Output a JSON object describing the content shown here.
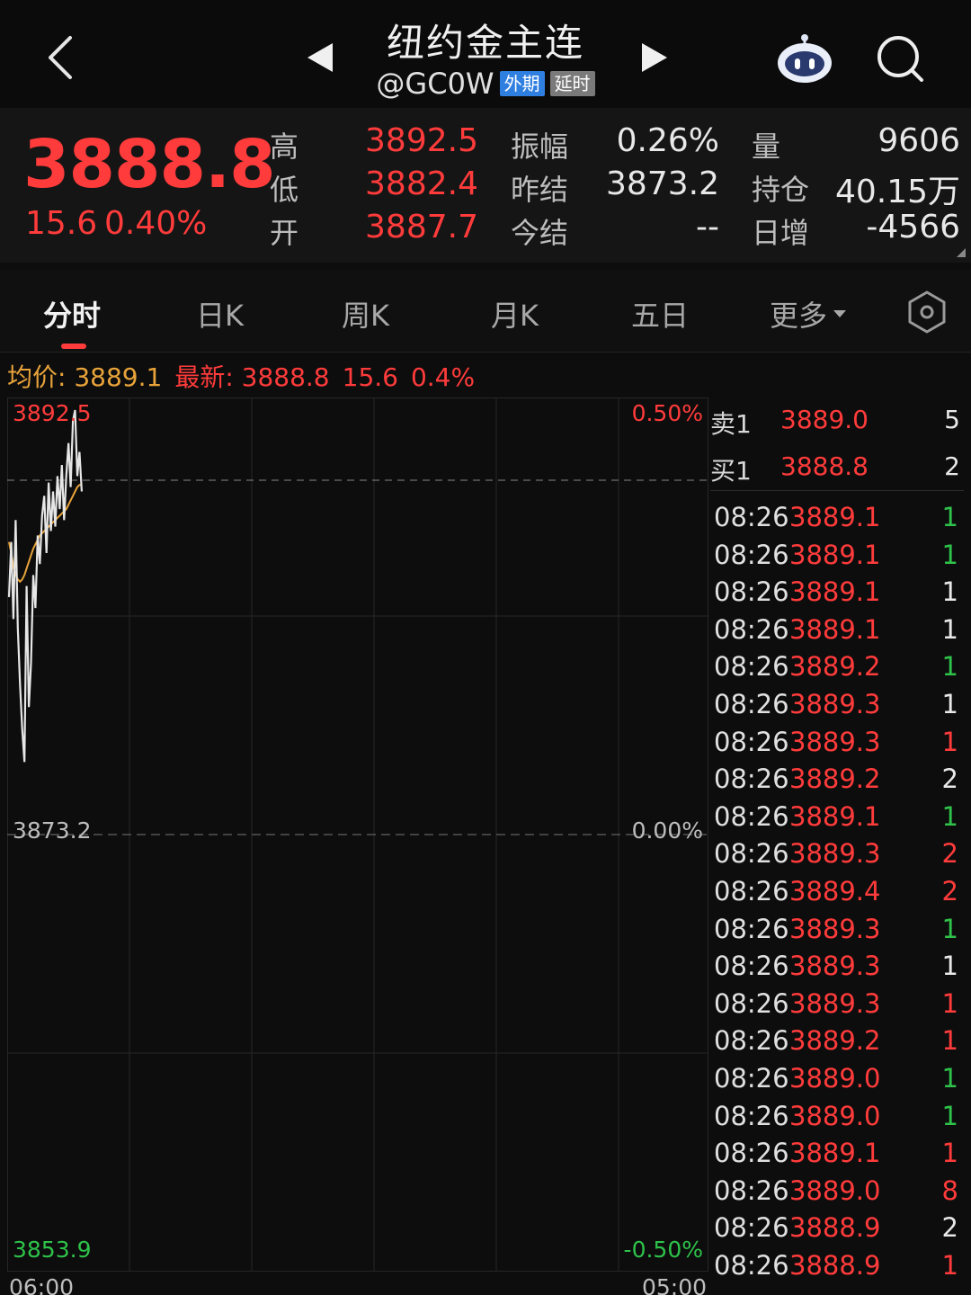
{
  "header": {
    "title": "纽约金主连",
    "symbol": "@GC0W",
    "tag_foreign": "外期",
    "tag_delay": "延时"
  },
  "quote": {
    "last": "3888.8",
    "change": "15.6",
    "change_pct": "0.40%",
    "high_label": "高",
    "high": "3892.5",
    "low_label": "低",
    "low": "3882.4",
    "open_label": "开",
    "open": "3887.7",
    "amp_label": "振幅",
    "amp": "0.26%",
    "prev_settle_label": "昨结",
    "prev_settle": "3873.2",
    "settle_label": "今结",
    "settle": "--",
    "vol_label": "量",
    "vol": "9606",
    "oi_label": "持仓",
    "oi": "40.15万",
    "oi_chg_label": "日增",
    "oi_chg": "-4566"
  },
  "tabs": [
    "分时",
    "日K",
    "周K",
    "月K",
    "五日",
    "更多"
  ],
  "info": {
    "avg": "均价: 3889.1",
    "latest": "最新: 3888.8",
    "chg": "15.6",
    "pct": "0.4%"
  },
  "chart_data": {
    "type": "line",
    "x_labels": [
      "06:00",
      "05:00"
    ],
    "y_left": [
      "3892.5",
      "3873.2",
      "3853.9"
    ],
    "y_right": [
      "0.50%",
      "0.00%",
      "-0.50%"
    ],
    "ylim": [
      3853.9,
      3892.5
    ],
    "baseline": 3873.2,
    "series": [
      {
        "values": [
          3884.0,
          3886.5,
          3883.0,
          3887.5,
          3882.6,
          3880.0,
          3878.0,
          3876.5,
          3884.5,
          3879.0,
          3881.0,
          3885.0,
          3883.5,
          3886.8,
          3885.5,
          3887.7,
          3888.6,
          3886.0,
          3889.2,
          3887.0,
          3888.8,
          3887.2,
          3889.5,
          3888.0,
          3890.0,
          3887.5,
          3889.5,
          3891.0,
          3889.0,
          3892.0,
          3892.5,
          3889.5,
          3890.6,
          3888.8
        ]
      },
      {
        "values": [
          3886.5,
          3886.0,
          3885.4,
          3885.0,
          3884.8,
          3884.7,
          3884.8,
          3885.0,
          3885.3,
          3885.6,
          3885.9,
          3886.2,
          3886.4,
          3886.6,
          3886.8,
          3886.9,
          3887.0,
          3887.1,
          3887.2,
          3887.3,
          3887.4,
          3887.5,
          3887.6,
          3887.7,
          3887.8,
          3887.9,
          3888.0,
          3888.2,
          3888.4,
          3888.6,
          3888.8,
          3889.0,
          3889.1,
          3889.1
        ]
      }
    ]
  },
  "orderbook": [
    {
      "label": "卖1",
      "price": "3889.0",
      "vol": "5"
    },
    {
      "label": "买1",
      "price": "3888.8",
      "vol": "2"
    }
  ],
  "ticks": [
    {
      "t": "08:26",
      "p": "3889.1",
      "v": "1",
      "c": "#2ec24a"
    },
    {
      "t": "08:26",
      "p": "3889.1",
      "v": "1",
      "c": "#2ec24a"
    },
    {
      "t": "08:26",
      "p": "3889.1",
      "v": "1",
      "c": "#e8e8e8"
    },
    {
      "t": "08:26",
      "p": "3889.1",
      "v": "1",
      "c": "#e8e8e8"
    },
    {
      "t": "08:26",
      "p": "3889.2",
      "v": "1",
      "c": "#2ec24a"
    },
    {
      "t": "08:26",
      "p": "3889.3",
      "v": "1",
      "c": "#e8e8e8"
    },
    {
      "t": "08:26",
      "p": "3889.3",
      "v": "1",
      "c": "#ff3b3b"
    },
    {
      "t": "08:26",
      "p": "3889.2",
      "v": "2",
      "c": "#e8e8e8"
    },
    {
      "t": "08:26",
      "p": "3889.1",
      "v": "1",
      "c": "#2ec24a"
    },
    {
      "t": "08:26",
      "p": "3889.3",
      "v": "2",
      "c": "#ff3b3b"
    },
    {
      "t": "08:26",
      "p": "3889.4",
      "v": "2",
      "c": "#ff3b3b"
    },
    {
      "t": "08:26",
      "p": "3889.3",
      "v": "1",
      "c": "#2ec24a"
    },
    {
      "t": "08:26",
      "p": "3889.3",
      "v": "1",
      "c": "#e8e8e8"
    },
    {
      "t": "08:26",
      "p": "3889.3",
      "v": "1",
      "c": "#ff3b3b"
    },
    {
      "t": "08:26",
      "p": "3889.2",
      "v": "1",
      "c": "#ff3b3b"
    },
    {
      "t": "08:26",
      "p": "3889.0",
      "v": "1",
      "c": "#2ec24a"
    },
    {
      "t": "08:26",
      "p": "3889.0",
      "v": "1",
      "c": "#2ec24a"
    },
    {
      "t": "08:26",
      "p": "3889.1",
      "v": "1",
      "c": "#ff3b3b"
    },
    {
      "t": "08:26",
      "p": "3889.0",
      "v": "8",
      "c": "#ff3b3b"
    },
    {
      "t": "08:26",
      "p": "3888.9",
      "v": "2",
      "c": "#e8e8e8"
    },
    {
      "t": "08:26",
      "p": "3888.9",
      "v": "1",
      "c": "#ff3b3b"
    }
  ],
  "colors": {
    "up": "#ff3b3b",
    "down": "#2ec24a",
    "price_line": "#e6e6e6",
    "avg_line": "#e8a33a"
  }
}
